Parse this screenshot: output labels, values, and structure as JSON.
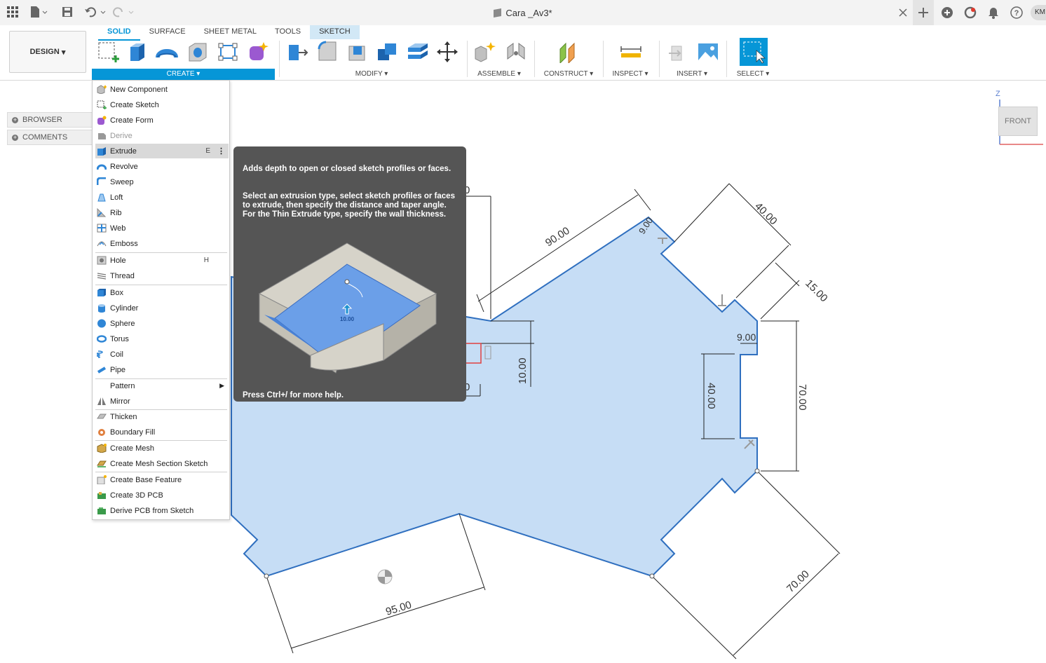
{
  "titlebar": {
    "document_title": "Cara _Av3*",
    "user_initials": "KM",
    "icons": [
      "apps-grid-icon",
      "file-icon",
      "save-icon",
      "undo-icon",
      "redo-icon",
      "close-tab-icon",
      "new-tab-icon",
      "extensions-icon",
      "job-status-icon",
      "notifications-icon",
      "help-icon"
    ]
  },
  "workspace": {
    "label": "DESIGN"
  },
  "tabs": [
    {
      "label": "SOLID",
      "active": true
    },
    {
      "label": "SURFACE",
      "active": false
    },
    {
      "label": "SHEET METAL",
      "active": false
    },
    {
      "label": "TOOLS",
      "active": false
    },
    {
      "label": "SKETCH",
      "active": false
    }
  ],
  "groups": {
    "create": "CREATE",
    "modify": "MODIFY",
    "assemble": "ASSEMBLE",
    "construct": "CONSTRUCT",
    "inspect": "INSPECT",
    "insert": "INSERT",
    "select": "SELECT"
  },
  "panels": {
    "browser": "BROWSER",
    "comments": "COMMENTS"
  },
  "menu": {
    "items": [
      {
        "label": "New Component",
        "icon": "new-component-icon"
      },
      {
        "label": "Create Sketch",
        "icon": "create-sketch-icon"
      },
      {
        "label": "Create Form",
        "icon": "create-form-icon"
      },
      {
        "label": "Derive",
        "icon": "derive-icon",
        "disabled": true
      },
      {
        "label": "Extrude",
        "icon": "extrude-icon",
        "shortcut": "E",
        "highlighted": true
      },
      {
        "label": "Revolve",
        "icon": "revolve-icon"
      },
      {
        "label": "Sweep",
        "icon": "sweep-icon"
      },
      {
        "label": "Loft",
        "icon": "loft-icon"
      },
      {
        "label": "Rib",
        "icon": "rib-icon"
      },
      {
        "label": "Web",
        "icon": "web-icon"
      },
      {
        "label": "Emboss",
        "icon": "emboss-icon"
      },
      {
        "label": "Hole",
        "icon": "hole-icon",
        "shortcut": "H"
      },
      {
        "label": "Thread",
        "icon": "thread-icon"
      },
      {
        "label": "Box",
        "icon": "box-icon"
      },
      {
        "label": "Cylinder",
        "icon": "cylinder-icon"
      },
      {
        "label": "Sphere",
        "icon": "sphere-icon"
      },
      {
        "label": "Torus",
        "icon": "torus-icon"
      },
      {
        "label": "Coil",
        "icon": "coil-icon"
      },
      {
        "label": "Pipe",
        "icon": "pipe-icon"
      },
      {
        "label": "Pattern",
        "icon": "",
        "submenu": true
      },
      {
        "label": "Mirror",
        "icon": "mirror-icon"
      },
      {
        "label": "Thicken",
        "icon": "thicken-icon"
      },
      {
        "label": "Boundary Fill",
        "icon": "boundary-fill-icon"
      },
      {
        "label": "Create Mesh",
        "icon": "create-mesh-icon"
      },
      {
        "label": "Create Mesh Section Sketch",
        "icon": "mesh-section-icon"
      },
      {
        "label": "Create Base Feature",
        "icon": "base-feature-icon"
      },
      {
        "label": "Create 3D PCB",
        "icon": "pcb-icon"
      },
      {
        "label": "Derive PCB from Sketch",
        "icon": "derive-pcb-icon"
      }
    ]
  },
  "tooltip": {
    "summary": "Adds depth to open or closed sketch profiles or faces.",
    "detail": "Select an extrusion type, select sketch profiles or faces to extrude, then specify the distance and taper angle. For the Thin Extrude type, specify the wall thickness.",
    "illustration_value": "10.00",
    "footer": "Press Ctrl+/ for more help."
  },
  "viewcube": {
    "face": "FRONT",
    "axis": "Z"
  },
  "dimensions": [
    "90.00",
    "9.00",
    "40.00",
    "15.00",
    "9.00",
    "70.00",
    "40.00",
    "10.00",
    "95.00",
    "70.00",
    "0",
    "0"
  ],
  "colors": {
    "accent": "#0696d7",
    "profile_fill": "#c6ddf5",
    "profile_edge": "#2f6fbf",
    "tooltip_bg": "#555555"
  }
}
